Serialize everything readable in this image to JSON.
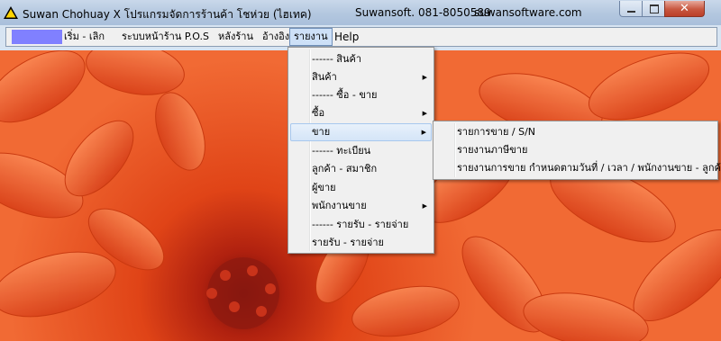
{
  "window": {
    "title": "Suwan Chohuay X   โปรแกรมจัดการร้านค้า โชห่วย  (ไฮเทค)",
    "vendor": "Suwansoft.  081-8050589",
    "website": "suwansoftware.com",
    "icons": {
      "app": "warning-triangle-icon",
      "minimize": "minimize-icon",
      "maximize": "maximize-icon",
      "close": "close-icon"
    }
  },
  "menubar": {
    "items": [
      {
        "label": "เริ่ม - เลิก"
      },
      {
        "label": "ระบบหน้าร้าน P.O.S"
      },
      {
        "label": "หลังร้าน"
      },
      {
        "label": "อ้างอิง"
      },
      {
        "label": "รายงาน",
        "active": true
      },
      {
        "label": "Help"
      }
    ],
    "logo_color": "#8080ff"
  },
  "report_menu": {
    "items": [
      {
        "label": "------  สินค้า",
        "separator_label": true
      },
      {
        "label": "สินค้า",
        "submenu": true
      },
      {
        "label": "------  ซื้อ - ขาย",
        "separator_label": true
      },
      {
        "label": "ซื้อ",
        "submenu": true
      },
      {
        "label": "ขาย",
        "submenu": true,
        "highlighted": true
      },
      {
        "label": "------  ทะเบียน",
        "separator_label": true
      },
      {
        "label": "ลูกค้า - สมาชิก"
      },
      {
        "label": "ผู้ขาย"
      },
      {
        "label": "พนักงานขาย",
        "submenu": true
      },
      {
        "label": "------  รายรับ - รายจ่าย",
        "separator_label": true
      },
      {
        "label": "รายรับ - รายจ่าย"
      }
    ],
    "arrow": "▶"
  },
  "sales_submenu": {
    "items": [
      {
        "label": "รายการขาย / S/N"
      },
      {
        "label": "รายงานภาษีขาย"
      },
      {
        "label": "รายงานการขาย กำหนดตามวันที่ / เวลา / พนักงานขาย - ลูกค้า"
      }
    ]
  },
  "background": {
    "image": "orange-chrysanthemum-wallpaper",
    "colors": [
      "#e2491c",
      "#f26a32",
      "#a31f12"
    ]
  }
}
